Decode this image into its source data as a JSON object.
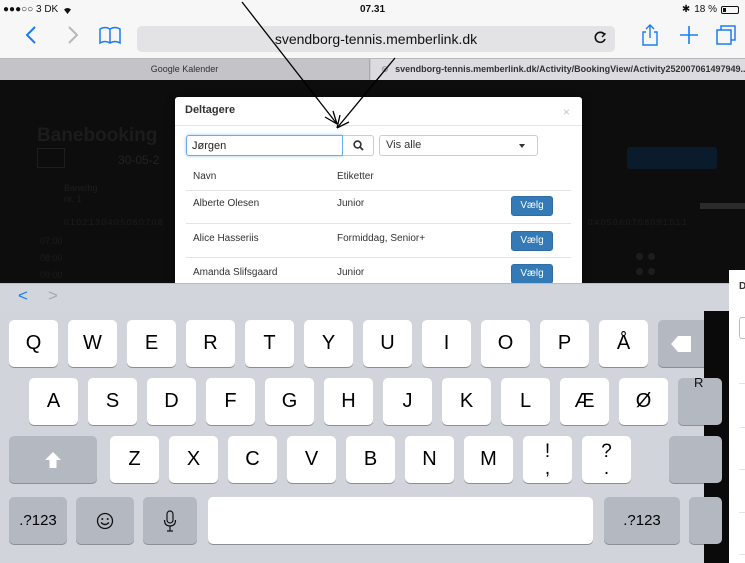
{
  "status_bar": {
    "carrier": "●●●○○ 3 DK",
    "time": "07.31",
    "battery": "18 %"
  },
  "safari": {
    "url": "svendborg-tennis.memberlink.dk",
    "back_icon": "chevron-left-icon",
    "forward_icon": "chevron-right-icon",
    "bookmarks_icon": "book-icon",
    "reload_icon": "reload-icon",
    "share_icon": "share-icon",
    "new_tab_icon": "plus-icon",
    "tabs_icon": "tabs-icon"
  },
  "tabs": [
    {
      "label": "Google Kalender"
    },
    {
      "label": "svendborg-tennis.memberlink.dk/Activity/BookingView/Activity252007061497949..."
    }
  ],
  "background_page": {
    "title": "Banebooking",
    "date": "30-05-2",
    "court_label_1": "Bane/bg",
    "court_label_2": "nr. 1",
    "time_rows": [
      "07:00",
      "08:00",
      "09:00"
    ],
    "hour_numbers_left": "0:1:0:2:1:3:0:4:0:5:0:6:0:7:0:8",
    "hour_numbers_right": "0:4:0:5:0:6:0:7:0:8:0:9:1:0:1:1"
  },
  "modal": {
    "title": "Deltagere",
    "close_label": "×",
    "search_value": "Jørgen",
    "search_icon": "search-icon",
    "filter_selected": "Vis alle",
    "columns": {
      "name": "Navn",
      "tags": "Etiketter"
    },
    "rows": [
      {
        "name": "Alberte Olesen",
        "tags": "Junior",
        "action": "Vælg"
      },
      {
        "name": "Alice Hasseriis",
        "tags": "Formiddag, Senior+",
        "action": "Vælg"
      },
      {
        "name": "Amanda Slifsgaard",
        "tags": "Junior",
        "action": "Vælg"
      }
    ]
  },
  "side_panel": {
    "heading_letter": "D"
  },
  "keyboard": {
    "assist_back": "<",
    "assist_forward": ">",
    "row1": [
      "Q",
      "W",
      "E",
      "R",
      "T",
      "Y",
      "U",
      "I",
      "O",
      "P",
      "Å"
    ],
    "row2": [
      "A",
      "S",
      "D",
      "F",
      "G",
      "H",
      "J",
      "K",
      "L",
      "Æ",
      "Ø"
    ],
    "row3": [
      "Z",
      "X",
      "C",
      "V",
      "B",
      "N",
      "M"
    ],
    "row3_special_1": {
      "top": "!",
      "bottom": ","
    },
    "row3_special_2": {
      "top": "?",
      "bottom": "."
    },
    "numbers_label": ".?123",
    "numbers_label_right": ".?123",
    "emoji_icon": "emoji-icon",
    "mic_icon": "microphone-icon",
    "shift_icon": "shift-icon",
    "delete_icon": "backspace-icon",
    "right_partial_key": "R"
  },
  "colors": {
    "ios_blue": "#1a7cf5",
    "primary_button": "#337ab7",
    "focus_border": "#66afe9",
    "keyboard_bg": "#d1d4da"
  }
}
